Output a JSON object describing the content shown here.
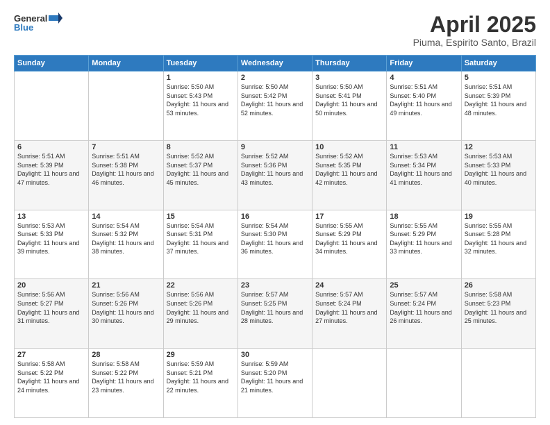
{
  "header": {
    "logo_line1": "General",
    "logo_line2": "Blue",
    "month_title": "April 2025",
    "location": "Piuma, Espirito Santo, Brazil"
  },
  "weekdays": [
    "Sunday",
    "Monday",
    "Tuesday",
    "Wednesday",
    "Thursday",
    "Friday",
    "Saturday"
  ],
  "weeks": [
    [
      {
        "day": "",
        "sunrise": "",
        "sunset": "",
        "daylight": ""
      },
      {
        "day": "",
        "sunrise": "",
        "sunset": "",
        "daylight": ""
      },
      {
        "day": "1",
        "sunrise": "Sunrise: 5:50 AM",
        "sunset": "Sunset: 5:43 PM",
        "daylight": "Daylight: 11 hours and 53 minutes."
      },
      {
        "day": "2",
        "sunrise": "Sunrise: 5:50 AM",
        "sunset": "Sunset: 5:42 PM",
        "daylight": "Daylight: 11 hours and 52 minutes."
      },
      {
        "day": "3",
        "sunrise": "Sunrise: 5:50 AM",
        "sunset": "Sunset: 5:41 PM",
        "daylight": "Daylight: 11 hours and 50 minutes."
      },
      {
        "day": "4",
        "sunrise": "Sunrise: 5:51 AM",
        "sunset": "Sunset: 5:40 PM",
        "daylight": "Daylight: 11 hours and 49 minutes."
      },
      {
        "day": "5",
        "sunrise": "Sunrise: 5:51 AM",
        "sunset": "Sunset: 5:39 PM",
        "daylight": "Daylight: 11 hours and 48 minutes."
      }
    ],
    [
      {
        "day": "6",
        "sunrise": "Sunrise: 5:51 AM",
        "sunset": "Sunset: 5:39 PM",
        "daylight": "Daylight: 11 hours and 47 minutes."
      },
      {
        "day": "7",
        "sunrise": "Sunrise: 5:51 AM",
        "sunset": "Sunset: 5:38 PM",
        "daylight": "Daylight: 11 hours and 46 minutes."
      },
      {
        "day": "8",
        "sunrise": "Sunrise: 5:52 AM",
        "sunset": "Sunset: 5:37 PM",
        "daylight": "Daylight: 11 hours and 45 minutes."
      },
      {
        "day": "9",
        "sunrise": "Sunrise: 5:52 AM",
        "sunset": "Sunset: 5:36 PM",
        "daylight": "Daylight: 11 hours and 43 minutes."
      },
      {
        "day": "10",
        "sunrise": "Sunrise: 5:52 AM",
        "sunset": "Sunset: 5:35 PM",
        "daylight": "Daylight: 11 hours and 42 minutes."
      },
      {
        "day": "11",
        "sunrise": "Sunrise: 5:53 AM",
        "sunset": "Sunset: 5:34 PM",
        "daylight": "Daylight: 11 hours and 41 minutes."
      },
      {
        "day": "12",
        "sunrise": "Sunrise: 5:53 AM",
        "sunset": "Sunset: 5:33 PM",
        "daylight": "Daylight: 11 hours and 40 minutes."
      }
    ],
    [
      {
        "day": "13",
        "sunrise": "Sunrise: 5:53 AM",
        "sunset": "Sunset: 5:33 PM",
        "daylight": "Daylight: 11 hours and 39 minutes."
      },
      {
        "day": "14",
        "sunrise": "Sunrise: 5:54 AM",
        "sunset": "Sunset: 5:32 PM",
        "daylight": "Daylight: 11 hours and 38 minutes."
      },
      {
        "day": "15",
        "sunrise": "Sunrise: 5:54 AM",
        "sunset": "Sunset: 5:31 PM",
        "daylight": "Daylight: 11 hours and 37 minutes."
      },
      {
        "day": "16",
        "sunrise": "Sunrise: 5:54 AM",
        "sunset": "Sunset: 5:30 PM",
        "daylight": "Daylight: 11 hours and 36 minutes."
      },
      {
        "day": "17",
        "sunrise": "Sunrise: 5:55 AM",
        "sunset": "Sunset: 5:29 PM",
        "daylight": "Daylight: 11 hours and 34 minutes."
      },
      {
        "day": "18",
        "sunrise": "Sunrise: 5:55 AM",
        "sunset": "Sunset: 5:29 PM",
        "daylight": "Daylight: 11 hours and 33 minutes."
      },
      {
        "day": "19",
        "sunrise": "Sunrise: 5:55 AM",
        "sunset": "Sunset: 5:28 PM",
        "daylight": "Daylight: 11 hours and 32 minutes."
      }
    ],
    [
      {
        "day": "20",
        "sunrise": "Sunrise: 5:56 AM",
        "sunset": "Sunset: 5:27 PM",
        "daylight": "Daylight: 11 hours and 31 minutes."
      },
      {
        "day": "21",
        "sunrise": "Sunrise: 5:56 AM",
        "sunset": "Sunset: 5:26 PM",
        "daylight": "Daylight: 11 hours and 30 minutes."
      },
      {
        "day": "22",
        "sunrise": "Sunrise: 5:56 AM",
        "sunset": "Sunset: 5:26 PM",
        "daylight": "Daylight: 11 hours and 29 minutes."
      },
      {
        "day": "23",
        "sunrise": "Sunrise: 5:57 AM",
        "sunset": "Sunset: 5:25 PM",
        "daylight": "Daylight: 11 hours and 28 minutes."
      },
      {
        "day": "24",
        "sunrise": "Sunrise: 5:57 AM",
        "sunset": "Sunset: 5:24 PM",
        "daylight": "Daylight: 11 hours and 27 minutes."
      },
      {
        "day": "25",
        "sunrise": "Sunrise: 5:57 AM",
        "sunset": "Sunset: 5:24 PM",
        "daylight": "Daylight: 11 hours and 26 minutes."
      },
      {
        "day": "26",
        "sunrise": "Sunrise: 5:58 AM",
        "sunset": "Sunset: 5:23 PM",
        "daylight": "Daylight: 11 hours and 25 minutes."
      }
    ],
    [
      {
        "day": "27",
        "sunrise": "Sunrise: 5:58 AM",
        "sunset": "Sunset: 5:22 PM",
        "daylight": "Daylight: 11 hours and 24 minutes."
      },
      {
        "day": "28",
        "sunrise": "Sunrise: 5:58 AM",
        "sunset": "Sunset: 5:22 PM",
        "daylight": "Daylight: 11 hours and 23 minutes."
      },
      {
        "day": "29",
        "sunrise": "Sunrise: 5:59 AM",
        "sunset": "Sunset: 5:21 PM",
        "daylight": "Daylight: 11 hours and 22 minutes."
      },
      {
        "day": "30",
        "sunrise": "Sunrise: 5:59 AM",
        "sunset": "Sunset: 5:20 PM",
        "daylight": "Daylight: 11 hours and 21 minutes."
      },
      {
        "day": "",
        "sunrise": "",
        "sunset": "",
        "daylight": ""
      },
      {
        "day": "",
        "sunrise": "",
        "sunset": "",
        "daylight": ""
      },
      {
        "day": "",
        "sunrise": "",
        "sunset": "",
        "daylight": ""
      }
    ]
  ]
}
